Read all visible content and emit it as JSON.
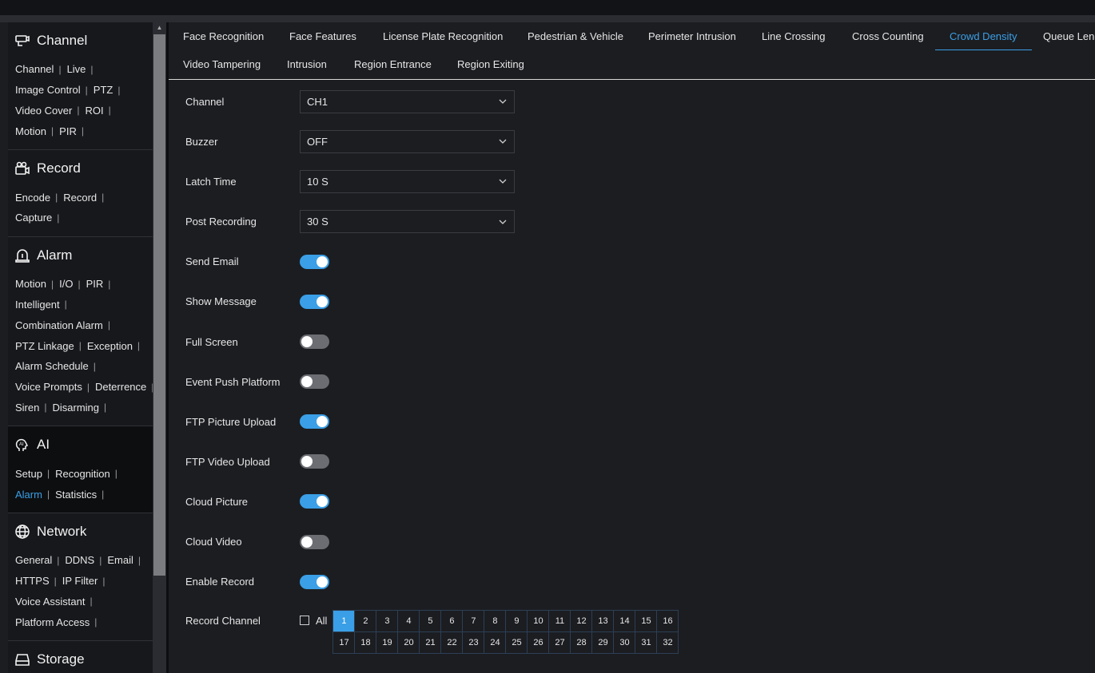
{
  "colors": {
    "accent": "#3a9fe6",
    "background": "#1c1d21",
    "sidebar": "#17181c"
  },
  "sidebar": {
    "sections": [
      {
        "title": "Channel",
        "icon": "camera-icon",
        "rows": [
          [
            "Channel",
            "Live"
          ],
          [
            "Image Control",
            "PTZ"
          ],
          [
            "Video Cover",
            "ROI"
          ],
          [
            "Motion",
            "PIR"
          ]
        ]
      },
      {
        "title": "Record",
        "icon": "video-recorder-icon",
        "rows": [
          [
            "Encode",
            "Record"
          ],
          [
            "Capture"
          ]
        ]
      },
      {
        "title": "Alarm",
        "icon": "alarm-siren-icon",
        "rows": [
          [
            "Motion",
            "I/O",
            "PIR"
          ],
          [
            "Intelligent"
          ],
          [
            "Combination Alarm"
          ],
          [
            "PTZ Linkage",
            "Exception"
          ],
          [
            "Alarm Schedule"
          ],
          [
            "Voice Prompts",
            "Deterrence"
          ],
          [
            "Siren",
            "Disarming"
          ]
        ]
      },
      {
        "title": "AI",
        "icon": "ai-head-icon",
        "rows": [
          [
            "Setup",
            "Recognition"
          ],
          [
            "Alarm",
            "Statistics"
          ]
        ],
        "active_link": "Alarm"
      },
      {
        "title": "Network",
        "icon": "globe-icon",
        "rows": [
          [
            "General",
            "DDNS",
            "Email"
          ],
          [
            "HTTPS",
            "IP Filter"
          ],
          [
            "Voice Assistant"
          ],
          [
            "Platform Access"
          ]
        ]
      },
      {
        "title": "Storage",
        "icon": "disk-icon",
        "rows": []
      }
    ]
  },
  "tabs": {
    "row1": [
      "Face Recognition",
      "Face Features",
      "License Plate Recognition",
      "Pedestrian & Vehicle",
      "Perimeter Intrusion",
      "Line Crossing",
      "Cross Counting",
      "Crowd Density",
      "Queue Leng"
    ],
    "row2": [
      "Video Tampering",
      "Intrusion",
      "Region Entrance",
      "Region Exiting"
    ],
    "active": "Crowd Density"
  },
  "form": {
    "selects": [
      {
        "label": "Channel",
        "value": "CH1"
      },
      {
        "label": "Buzzer",
        "value": "OFF"
      },
      {
        "label": "Latch Time",
        "value": "10 S"
      },
      {
        "label": "Post Recording",
        "value": "30 S"
      }
    ],
    "toggles": [
      {
        "label": "Send Email",
        "on": true
      },
      {
        "label": "Show Message",
        "on": true
      },
      {
        "label": "Full Screen",
        "on": false
      },
      {
        "label": "Event Push Platform",
        "on": false
      },
      {
        "label": "FTP Picture Upload",
        "on": true
      },
      {
        "label": "FTP Video Upload",
        "on": false
      },
      {
        "label": "Cloud Picture",
        "on": true
      },
      {
        "label": "Cloud Video",
        "on": false
      },
      {
        "label": "Enable Record",
        "on": true
      }
    ],
    "record_channel": {
      "label": "Record Channel",
      "all_label": "All",
      "all_checked": false,
      "channels": [
        "1",
        "2",
        "3",
        "4",
        "5",
        "6",
        "7",
        "8",
        "9",
        "10",
        "11",
        "12",
        "13",
        "14",
        "15",
        "16",
        "17",
        "18",
        "19",
        "20",
        "21",
        "22",
        "23",
        "24",
        "25",
        "26",
        "27",
        "28",
        "29",
        "30",
        "31",
        "32"
      ],
      "selected": [
        "1"
      ]
    }
  }
}
